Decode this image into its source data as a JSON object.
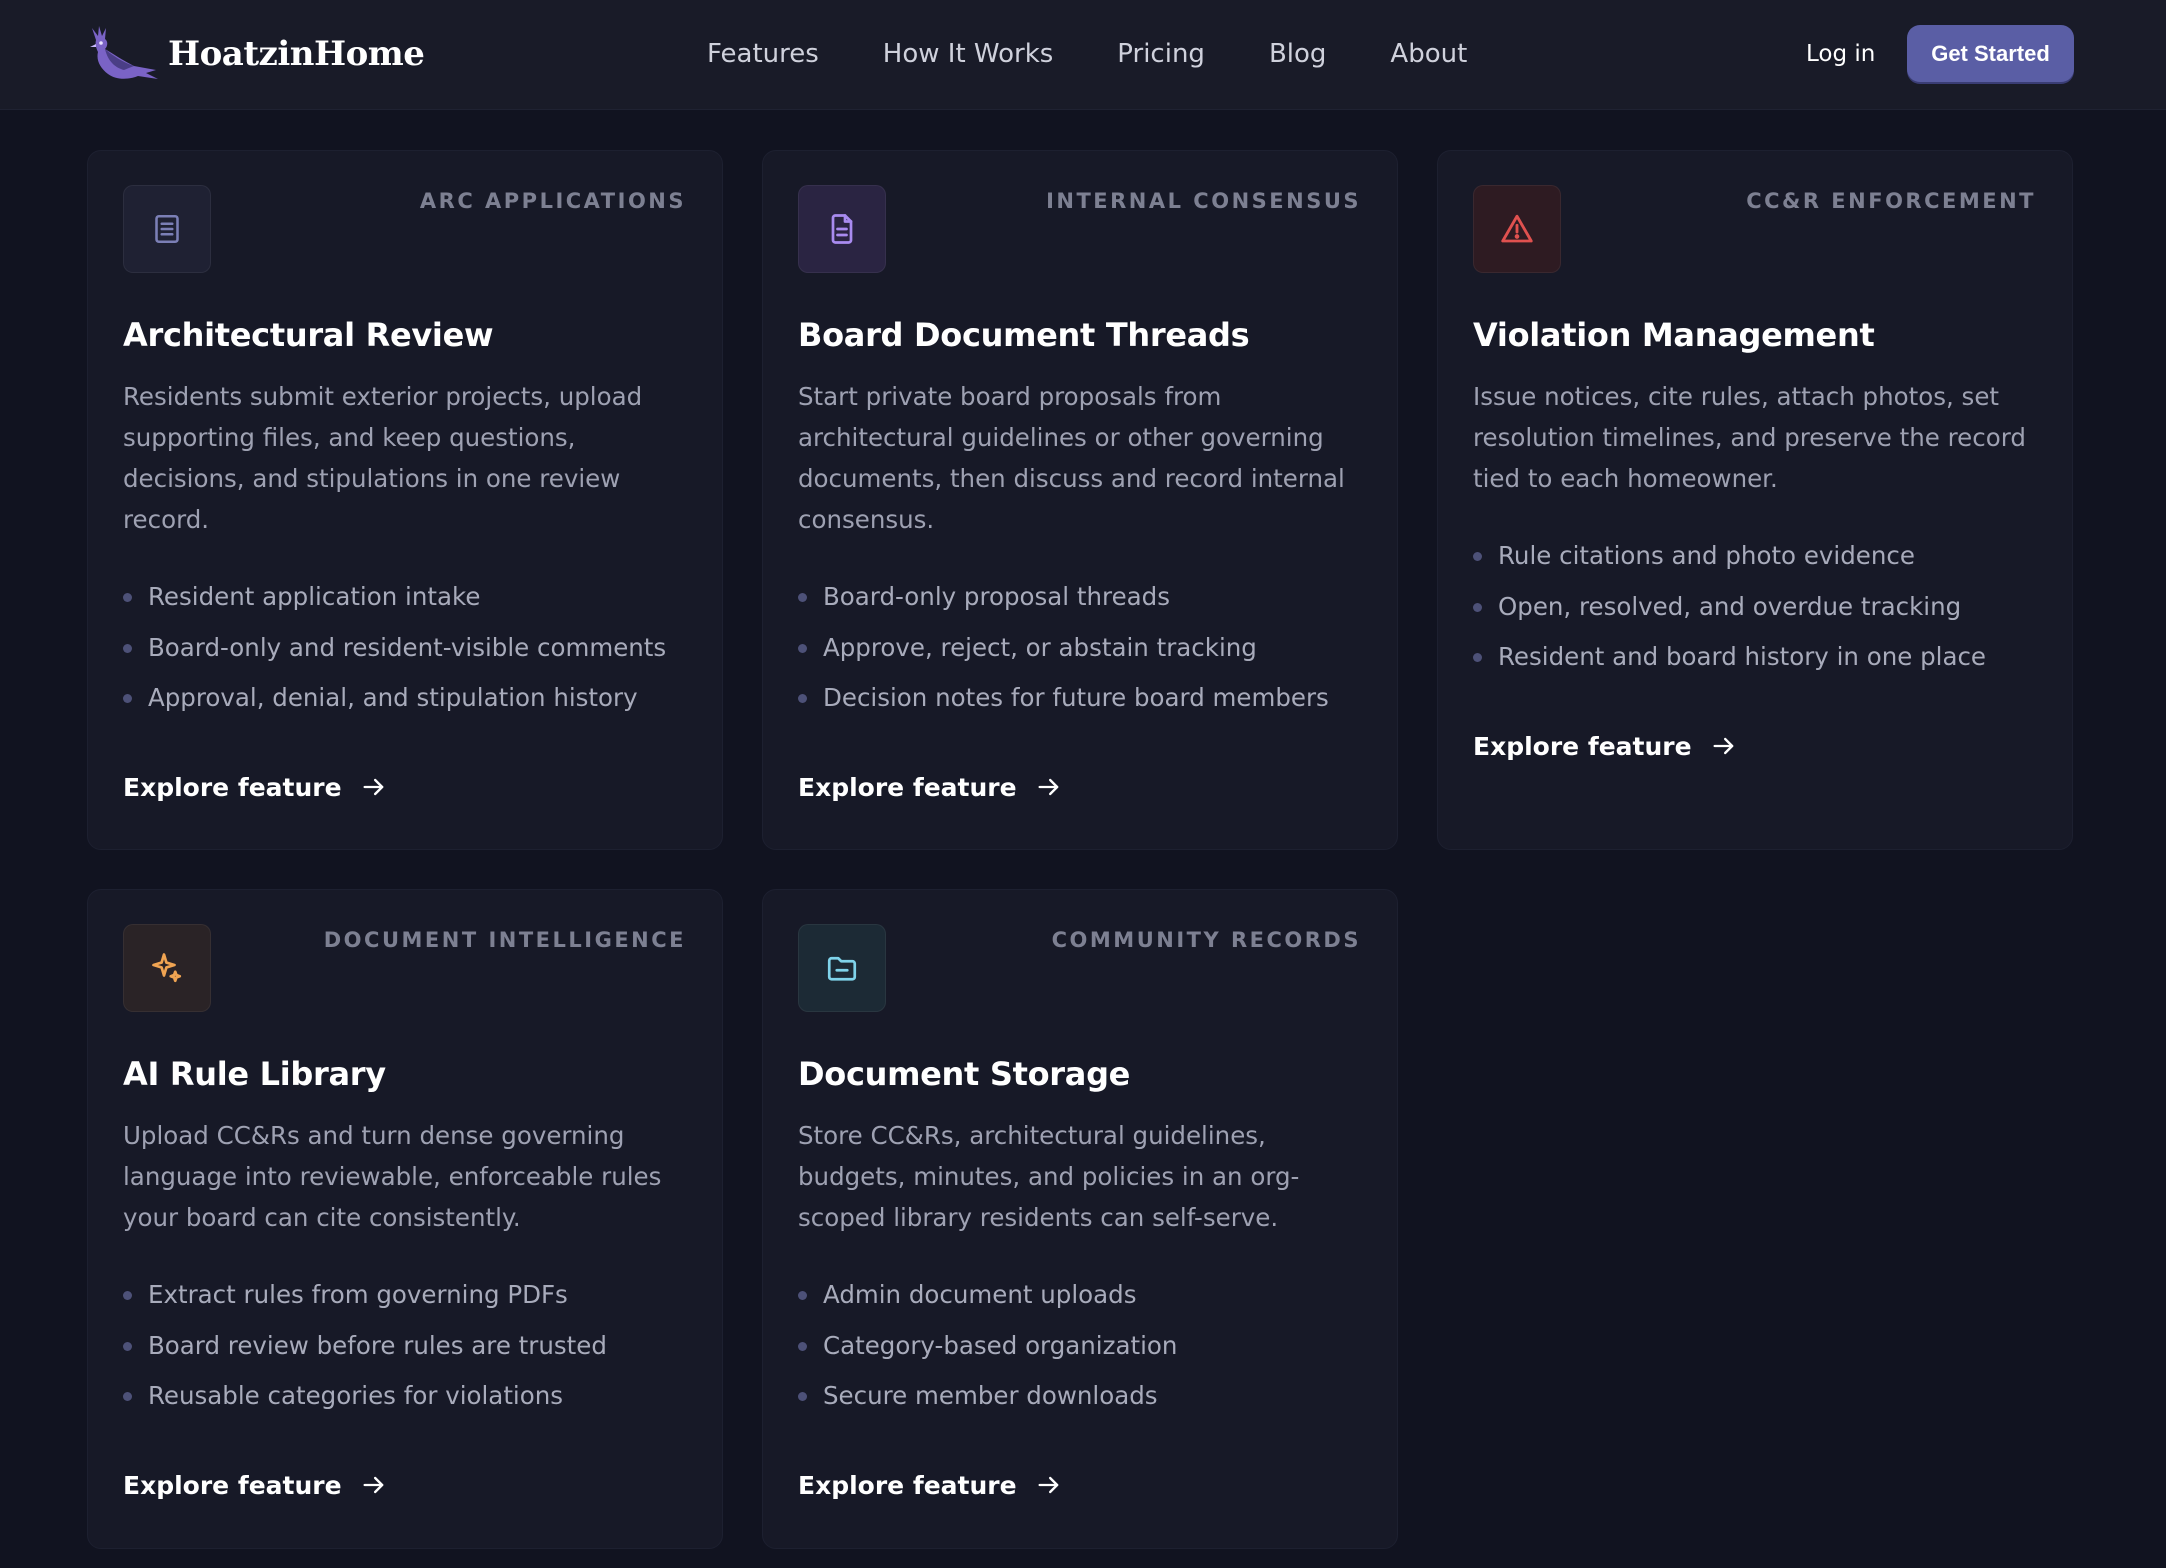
{
  "brand": {
    "name": "HoatzinHome",
    "logo_icon": "hoatzin-bird-icon"
  },
  "nav": {
    "links": [
      "Features",
      "How It Works",
      "Pricing",
      "Blog",
      "About"
    ],
    "login_label": "Log in",
    "cta_label": "Get Started"
  },
  "colors": {
    "background": "#111320",
    "card": "#171927",
    "accent": "#5a5ea5",
    "purple": "#a084e8",
    "danger": "#e0514f",
    "gold": "#f0a452",
    "cyan": "#7fd3ea"
  },
  "cards": [
    {
      "tag": "ARC APPLICATIONS",
      "icon": "document-lines-icon",
      "title": "Architectural Review",
      "description": "Residents submit exterior projects, upload supporting files, and keep questions, decisions, and stipulations in one review record.",
      "bullets": [
        "Resident application intake",
        "Board-only and resident-visible comments",
        "Approval, denial, and stipulation history"
      ],
      "link": "Explore feature"
    },
    {
      "tag": "INTERNAL CONSENSUS",
      "icon": "file-text-icon",
      "title": "Board Document Threads",
      "description": "Start private board proposals from architectural guidelines or other governing documents, then discuss and record internal consensus.",
      "bullets": [
        "Board-only proposal threads",
        "Approve, reject, or abstain tracking",
        "Decision notes for future board members"
      ],
      "link": "Explore feature"
    },
    {
      "tag": "CC&R ENFORCEMENT",
      "icon": "warning-triangle-icon",
      "title": "Violation Management",
      "description": "Issue notices, cite rules, attach photos, set resolution timelines, and preserve the record tied to each homeowner.",
      "bullets": [
        "Rule citations and photo evidence",
        "Open, resolved, and overdue tracking",
        "Resident and board history in one place"
      ],
      "link": "Explore feature"
    },
    {
      "tag": "DOCUMENT INTELLIGENCE",
      "icon": "sparkles-icon",
      "title": "AI Rule Library",
      "description": "Upload CC&Rs and turn dense governing language into reviewable, enforceable rules your board can cite consistently.",
      "bullets": [
        "Extract rules from governing PDFs",
        "Board review before rules are trusted",
        "Reusable categories for violations"
      ],
      "link": "Explore feature"
    },
    {
      "tag": "COMMUNITY RECORDS",
      "icon": "folder-icon",
      "title": "Document Storage",
      "description": "Store CC&Rs, architectural guidelines, budgets, minutes, and policies in an org-scoped library residents can self-serve.",
      "bullets": [
        "Admin document uploads",
        "Category-based organization",
        "Secure member downloads"
      ],
      "link": "Explore feature"
    }
  ]
}
